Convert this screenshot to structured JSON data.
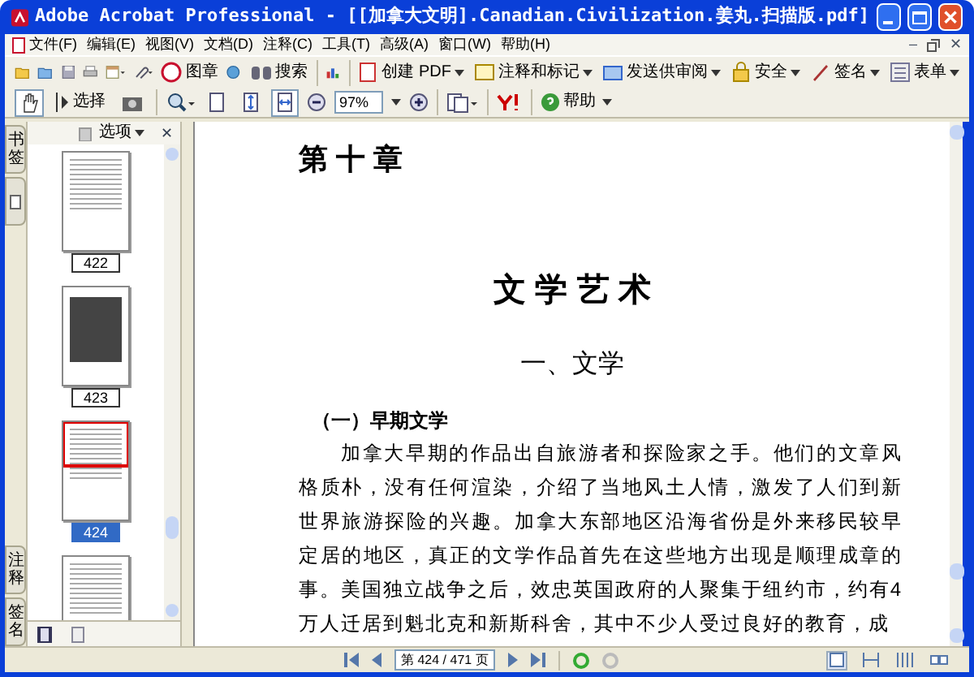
{
  "window": {
    "title": "Adobe Acrobat Professional - [[加拿大文明].Canadian.Civilization.姜丸.扫描版.pdf]",
    "close_glyph": "✕",
    "doc_minimize_glyph": "–",
    "doc_close_glyph": "✕"
  },
  "menu": [
    "文件(F)",
    "编辑(E)",
    "视图(V)",
    "文档(D)",
    "注释(C)",
    "工具(T)",
    "高级(A)",
    "窗口(W)",
    "帮助(H)"
  ],
  "toolbar": {
    "stamp_label": "图章",
    "search_label": "搜索",
    "tasks": [
      "创建 PDF",
      "注释和标记",
      "发送供审阅",
      "安全",
      "签名",
      "表单"
    ]
  },
  "toolbar_2": {
    "tools": [
      {
        "kind": "hand",
        "selected": true
      },
      {
        "kind": "select",
        "label": "选择",
        "selected": false
      },
      {
        "kind": "snapshot",
        "selected": false
      }
    ],
    "views": [
      {
        "kind": "actual",
        "selected": false
      },
      {
        "kind": "fit_page",
        "selected": false
      },
      {
        "kind": "fit_width",
        "selected": true
      }
    ],
    "zoom_value": "97%",
    "help_label": "帮助"
  },
  "nav_panel": {
    "options_label": "选项",
    "close_glyph": "✕",
    "side_tabs": [
      {
        "label": "书签",
        "kind": "text"
      },
      {
        "kind": "icon"
      },
      {
        "label": "注释",
        "kind": "text"
      },
      {
        "label": "签名",
        "kind": "text"
      }
    ],
    "thumbnails": [
      {
        "label": "422",
        "kind": "text",
        "selected": false
      },
      {
        "label": "423",
        "kind": "photo",
        "selected": false
      },
      {
        "label": "424",
        "kind": "text",
        "selected": true
      },
      {
        "kind": "text",
        "selected": false
      }
    ]
  },
  "document": {
    "chapter": "第 十 章",
    "title": "文 学 艺 术",
    "section": "一、文学",
    "subsection": "（一）早期文学",
    "paragraph": "加拿大早期的作品出自旅游者和探险家之手。他们的文章风格质朴，没有任何渲染，介绍了当地风土人情，激发了人们到新世界旅游探险的兴趣。加拿大东部地区沿海省份是外来移民较早定居的地区，真正的文学作品首先在这些地方出现是顺理成章的事。美国独立战争之后，效忠英国政府的人聚集于纽约市，约有4 万人迁居到魁北克和新斯科舍，其中不少人受过良好的教育，成"
  },
  "status_bar": {
    "page_field": "第 424 / 471 页",
    "view_modes": [
      {
        "kind": "single",
        "selected": true
      },
      {
        "kind": "continuous",
        "selected": false
      },
      {
        "kind": "facing",
        "selected": false
      },
      {
        "kind": "continuous_facing",
        "selected": false
      }
    ]
  }
}
